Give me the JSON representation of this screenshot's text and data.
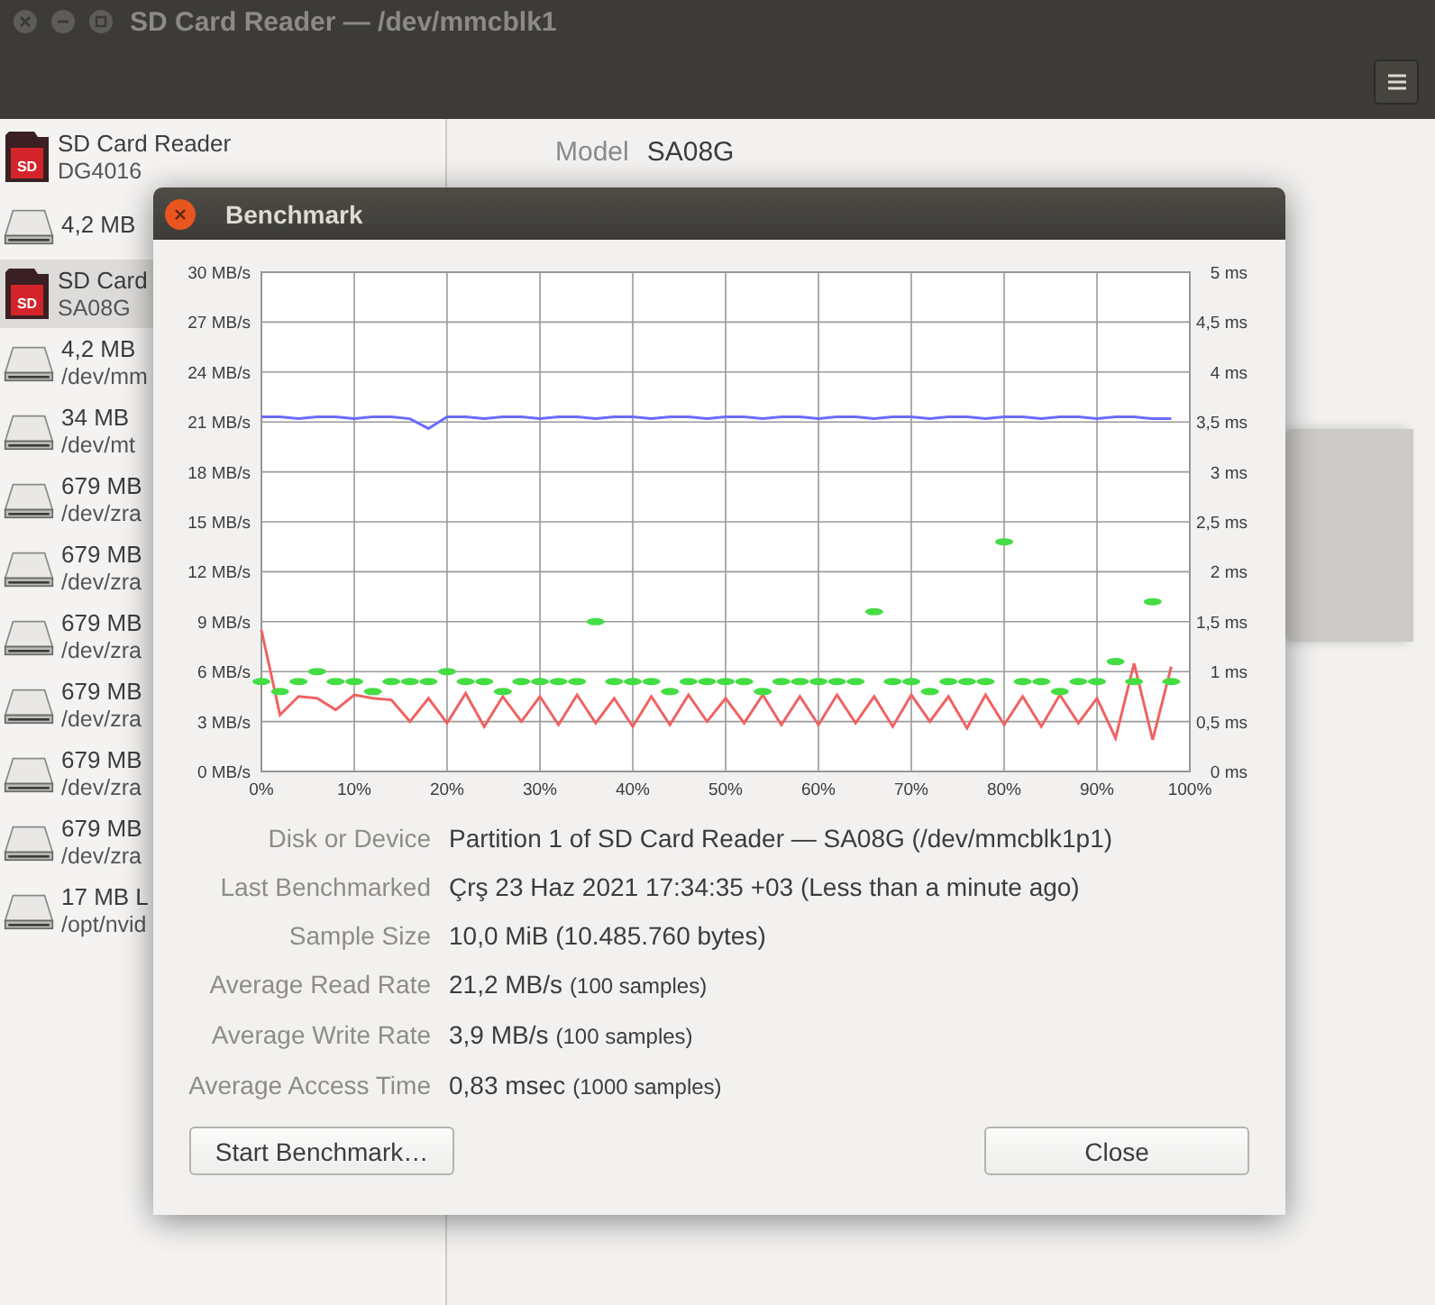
{
  "window": {
    "title": "SD Card Reader — /dev/mmcblk1"
  },
  "sidebar": {
    "items": [
      {
        "kind": "sd",
        "icon_text": "SD",
        "title": "SD Card Reader",
        "subtitle": "DG4016",
        "selected": false
      },
      {
        "kind": "disk",
        "title": "4,2 MB",
        "selected": false
      },
      {
        "kind": "sd",
        "icon_text": "SD",
        "title": "SD Card",
        "subtitle": "SA08G",
        "selected": true
      },
      {
        "kind": "disk",
        "title": "4,2 MB",
        "subtitle": "/dev/mm",
        "selected": false
      },
      {
        "kind": "disk",
        "title": "34 MB",
        "subtitle": "/dev/mt",
        "selected": false
      },
      {
        "kind": "disk",
        "title": "679 MB",
        "subtitle": "/dev/zra",
        "selected": false
      },
      {
        "kind": "disk",
        "title": "679 MB",
        "subtitle": "/dev/zra",
        "selected": false
      },
      {
        "kind": "disk",
        "title": "679 MB",
        "subtitle": "/dev/zra",
        "selected": false
      },
      {
        "kind": "disk",
        "title": "679 MB",
        "subtitle": "/dev/zra",
        "selected": false
      },
      {
        "kind": "disk",
        "title": "679 MB",
        "subtitle": "/dev/zra",
        "selected": false
      },
      {
        "kind": "disk",
        "title": "679 MB",
        "subtitle": "/dev/zra",
        "selected": false
      },
      {
        "kind": "disk",
        "title": "17 MB L",
        "subtitle": "/opt/nvid",
        "selected": false
      }
    ]
  },
  "details": {
    "label": "Model",
    "value": "SA08G"
  },
  "dialog": {
    "title": "Benchmark",
    "chart_data": {
      "type": "line",
      "grid": true,
      "x": [
        0,
        2,
        4,
        6,
        8,
        10,
        12,
        14,
        16,
        18,
        20,
        22,
        24,
        26,
        28,
        30,
        32,
        34,
        36,
        38,
        40,
        42,
        44,
        46,
        48,
        50,
        52,
        54,
        56,
        58,
        60,
        62,
        64,
        66,
        68,
        70,
        72,
        74,
        76,
        78,
        80,
        82,
        84,
        86,
        88,
        90,
        92,
        94,
        96,
        98
      ],
      "xlim": [
        0,
        100
      ],
      "ylim": [
        0,
        30
      ],
      "y2lim": [
        0,
        5
      ],
      "xticks": [
        {
          "value": 0,
          "label": "0%"
        },
        {
          "value": 10,
          "label": "10%"
        },
        {
          "value": 20,
          "label": "20%"
        },
        {
          "value": 30,
          "label": "30%"
        },
        {
          "value": 40,
          "label": "40%"
        },
        {
          "value": 50,
          "label": "50%"
        },
        {
          "value": 60,
          "label": "60%"
        },
        {
          "value": 70,
          "label": "70%"
        },
        {
          "value": 80,
          "label": "80%"
        },
        {
          "value": 90,
          "label": "90%"
        },
        {
          "value": 100,
          "label": "100%"
        }
      ],
      "yticks": [
        {
          "value": 0,
          "label": "0 MB/s"
        },
        {
          "value": 3,
          "label": "3 MB/s"
        },
        {
          "value": 6,
          "label": "6 MB/s"
        },
        {
          "value": 9,
          "label": "9 MB/s"
        },
        {
          "value": 12,
          "label": "12 MB/s"
        },
        {
          "value": 15,
          "label": "15 MB/s"
        },
        {
          "value": 18,
          "label": "18 MB/s"
        },
        {
          "value": 21,
          "label": "21 MB/s"
        },
        {
          "value": 24,
          "label": "24 MB/s"
        },
        {
          "value": 27,
          "label": "27 MB/s"
        },
        {
          "value": 30,
          "label": "30 MB/s"
        }
      ],
      "y2ticks": [
        {
          "value": 0,
          "label": "0 ms"
        },
        {
          "value": 0.5,
          "label": "0,5 ms"
        },
        {
          "value": 1,
          "label": "1 ms"
        },
        {
          "value": 1.5,
          "label": "1,5 ms"
        },
        {
          "value": 2,
          "label": "2 ms"
        },
        {
          "value": 2.5,
          "label": "2,5 ms"
        },
        {
          "value": 3,
          "label": "3 ms"
        },
        {
          "value": 3.5,
          "label": "3,5 ms"
        },
        {
          "value": 4,
          "label": "4 ms"
        },
        {
          "value": 4.5,
          "label": "4,5 ms"
        },
        {
          "value": 5,
          "label": "5 ms"
        }
      ],
      "series": [
        {
          "color": "#6b6bff",
          "values": [
            21.3,
            21.3,
            21.2,
            21.3,
            21.3,
            21.2,
            21.3,
            21.3,
            21.2,
            20.6,
            21.3,
            21.3,
            21.2,
            21.3,
            21.3,
            21.2,
            21.3,
            21.3,
            21.2,
            21.3,
            21.3,
            21.2,
            21.3,
            21.3,
            21.2,
            21.3,
            21.3,
            21.2,
            21.3,
            21.3,
            21.2,
            21.3,
            21.3,
            21.2,
            21.3,
            21.3,
            21.2,
            21.3,
            21.3,
            21.2,
            21.3,
            21.3,
            21.2,
            21.3,
            21.3,
            21.2,
            21.3,
            21.3,
            21.2,
            21.2
          ]
        },
        {
          "color": "#f06262",
          "values": [
            8.5,
            3.4,
            4.5,
            4.4,
            3.7,
            4.6,
            4.4,
            4.3,
            3.0,
            4.4,
            2.9,
            4.7,
            2.7,
            4.5,
            3.0,
            4.5,
            2.8,
            4.6,
            2.9,
            4.4,
            2.7,
            4.5,
            2.8,
            4.6,
            3.0,
            4.4,
            2.9,
            4.6,
            2.8,
            4.5,
            2.8,
            4.6,
            2.9,
            4.5,
            2.7,
            4.6,
            3.0,
            4.5,
            2.6,
            4.6,
            2.8,
            4.5,
            2.7,
            4.6,
            2.9,
            4.4,
            2.0,
            6.5,
            1.9,
            6.3
          ]
        },
        {
          "type": "scatter",
          "axis": "y2",
          "color": "#44dd44",
          "values": [
            0.9,
            0.8,
            0.9,
            1,
            0.9,
            0.9,
            0.8,
            0.9,
            0.9,
            0.9,
            1,
            0.9,
            0.9,
            0.8,
            0.9,
            0.9,
            0.9,
            0.9,
            1.5,
            0.9,
            0.9,
            0.9,
            0.8,
            0.9,
            0.9,
            0.9,
            0.9,
            0.8,
            0.9,
            0.9,
            0.9,
            0.9,
            0.9,
            1.6,
            0.9,
            0.9,
            0.8,
            0.9,
            0.9,
            0.9,
            2.3,
            0.9,
            0.9,
            0.8,
            0.9,
            0.9,
            1.1,
            0.9,
            1.7,
            0.9
          ]
        }
      ]
    },
    "info": [
      {
        "label": "Disk or Device",
        "value": "Partition 1 of SD Card Reader — SA08G (/dev/mmcblk1p1)"
      },
      {
        "label": "Last Benchmarked",
        "value": "Çrş 23 Haz 2021 17:34:35 +03 (Less than a minute ago)"
      },
      {
        "label": "Sample Size",
        "value": "10,0 MiB (10.485.760 bytes)"
      },
      {
        "label": "Average Read Rate",
        "value": "21,2 MB/s",
        "note": "(100 samples)"
      },
      {
        "label": "Average Write Rate",
        "value": "3,9 MB/s",
        "note": "(100 samples)"
      },
      {
        "label": "Average Access Time",
        "value": "0,83 msec",
        "note": "(1000 samples)"
      }
    ],
    "buttons": [
      "Start Benchmark…",
      "Close"
    ]
  }
}
